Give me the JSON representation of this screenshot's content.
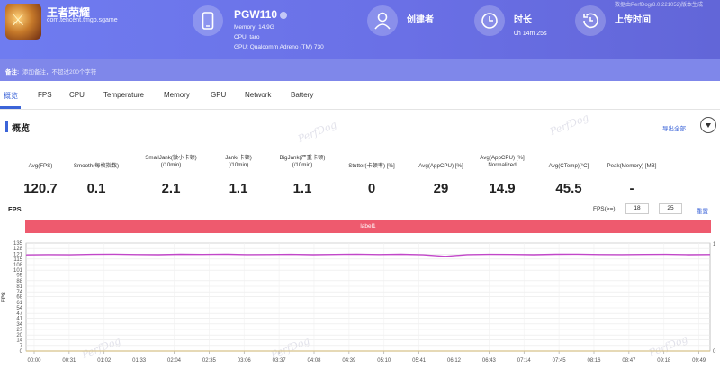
{
  "header": {
    "app_name": "王者荣耀",
    "package": "com.tencent.tmgp.sgame",
    "watermark_text": "数据由PerfDog(8.0.221052)版本生成",
    "device": {
      "name": "PGW110",
      "memory": "Memory: 14.9G",
      "cpu": "CPU: taro",
      "gpu": "GPU: Qualcomm Adreno (TM) 730"
    },
    "creator_label": "创建者",
    "duration_label": "时长",
    "duration_value": "0h 14m 25s",
    "upload_label": "上传时间"
  },
  "remark": {
    "label": "备注:",
    "placeholder": "添加备注，不超过200个字符"
  },
  "tabs": [
    "概览",
    "FPS",
    "CPU",
    "Temperature",
    "Memory",
    "GPU",
    "Network",
    "Battery"
  ],
  "overview": {
    "title": "概览",
    "export_label": "导出全部",
    "metrics": [
      {
        "label": "Avg(FPS)",
        "value": "120.7"
      },
      {
        "label": "Smooth(每帧指数)",
        "value": "0.1"
      },
      {
        "label": "SmallJank(微小卡顿)\n(/10min)",
        "value": "2.1"
      },
      {
        "label": "Jank(卡顿)\n(/10min)",
        "value": "1.1"
      },
      {
        "label": "BigJank(严重卡顿)\n(/10min)",
        "value": "1.1"
      },
      {
        "label": "Stutter(卡顿率) [%]",
        "value": "0"
      },
      {
        "label": "Avg(AppCPU) [%]",
        "value": "29"
      },
      {
        "label": "Avg(AppCPU) [%]\nNormalized",
        "value": "14.9"
      },
      {
        "label": "Avg(CTemp)[°C]",
        "value": "45.5"
      },
      {
        "label": "Peak(Memory) [MB]",
        "value": "-"
      }
    ],
    "watermark": "PerfDog"
  },
  "chart_controls": {
    "title": "FPS",
    "filter_label": "FPS(>=)",
    "filter_min": "18",
    "filter_max": "25",
    "reset_label": "重置",
    "label_bar": "label1",
    "y_axis_name": "FPS"
  },
  "colors": {
    "fps_line": "#c247c9",
    "jank_line": "#d8c28a",
    "label_bar": "#ee5a6e",
    "accent": "#3b64d8"
  },
  "chart_data": {
    "type": "line",
    "xlabel": "",
    "ylabel": "FPS",
    "ylim": [
      0,
      135
    ],
    "y_ticks": [
      0,
      7,
      14,
      20,
      27,
      34,
      41,
      47,
      54,
      61,
      68,
      74,
      81,
      88,
      95,
      101,
      108,
      115,
      121,
      128,
      135
    ],
    "right_y_ticks": [
      0,
      1
    ],
    "x_ticks": [
      "00:00",
      "00:31",
      "01:02",
      "01:33",
      "02:04",
      "02:35",
      "03:06",
      "03:37",
      "04:08",
      "04:39",
      "05:10",
      "05:41",
      "06:12",
      "06:43",
      "07:14",
      "07:45",
      "08:16",
      "08:47",
      "09:18",
      "09:49"
    ],
    "series": [
      {
        "name": "FPS",
        "values": [
          120.2,
          120.5,
          120.3,
          120.8,
          121.0,
          120.6,
          120.4,
          120.9,
          120.7,
          121.1,
          120.5,
          120.6,
          120.8,
          120.4,
          120.7,
          121.0,
          120.6,
          120.9,
          120.3,
          118.4,
          120.5,
          120.8,
          120.7,
          120.4,
          120.9,
          121.0,
          120.6,
          120.5,
          120.7,
          120.8,
          120.4,
          120.6
        ]
      },
      {
        "name": "Jank",
        "values": [
          0,
          0,
          0,
          0,
          0,
          0,
          0,
          0,
          0,
          0,
          0,
          0,
          0,
          0,
          0,
          0,
          0,
          0,
          0,
          0,
          0,
          0,
          0,
          0,
          0,
          0,
          0,
          0,
          0,
          0,
          0,
          0
        ]
      }
    ],
    "grid": true
  }
}
